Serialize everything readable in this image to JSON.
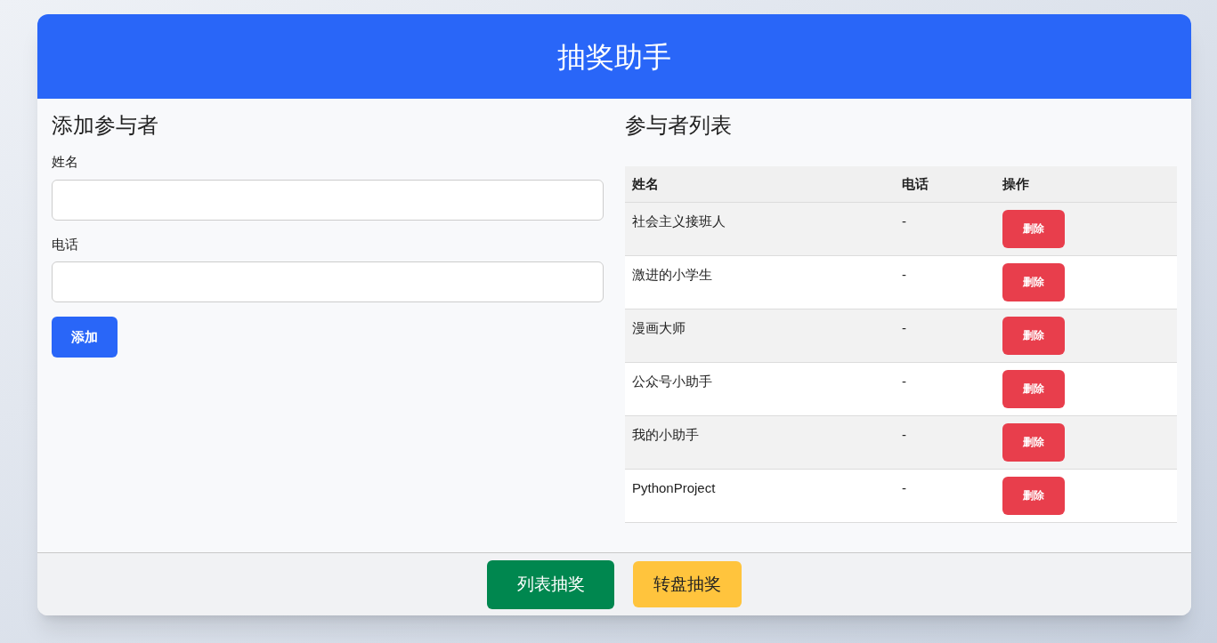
{
  "header": {
    "title": "抽奖助手"
  },
  "add_form": {
    "title": "添加参与者",
    "fields": [
      {
        "label": "姓名"
      },
      {
        "label": "电话"
      }
    ],
    "submit": "添加"
  },
  "participants": {
    "title": "参与者列表",
    "columns": [
      "姓名",
      "电话",
      "操作"
    ],
    "rows": [
      {
        "name": "社会主义接班人",
        "phone": "-",
        "action": "删除"
      },
      {
        "name": "激进的小学生",
        "phone": "-",
        "action": "删除"
      },
      {
        "name": "漫画大师",
        "phone": "-",
        "action": "删除"
      },
      {
        "name": "公众号小助手",
        "phone": "-",
        "action": "删除"
      },
      {
        "name": "我的小助手",
        "phone": "-",
        "action": "删除"
      },
      {
        "name": "PythonProject",
        "phone": "-",
        "action": "删除"
      }
    ]
  },
  "footer": {
    "buttons": [
      {
        "label": "列表抽奖",
        "kind": "success"
      },
      {
        "label": "转盘抽奖",
        "kind": "warning"
      }
    ]
  }
}
